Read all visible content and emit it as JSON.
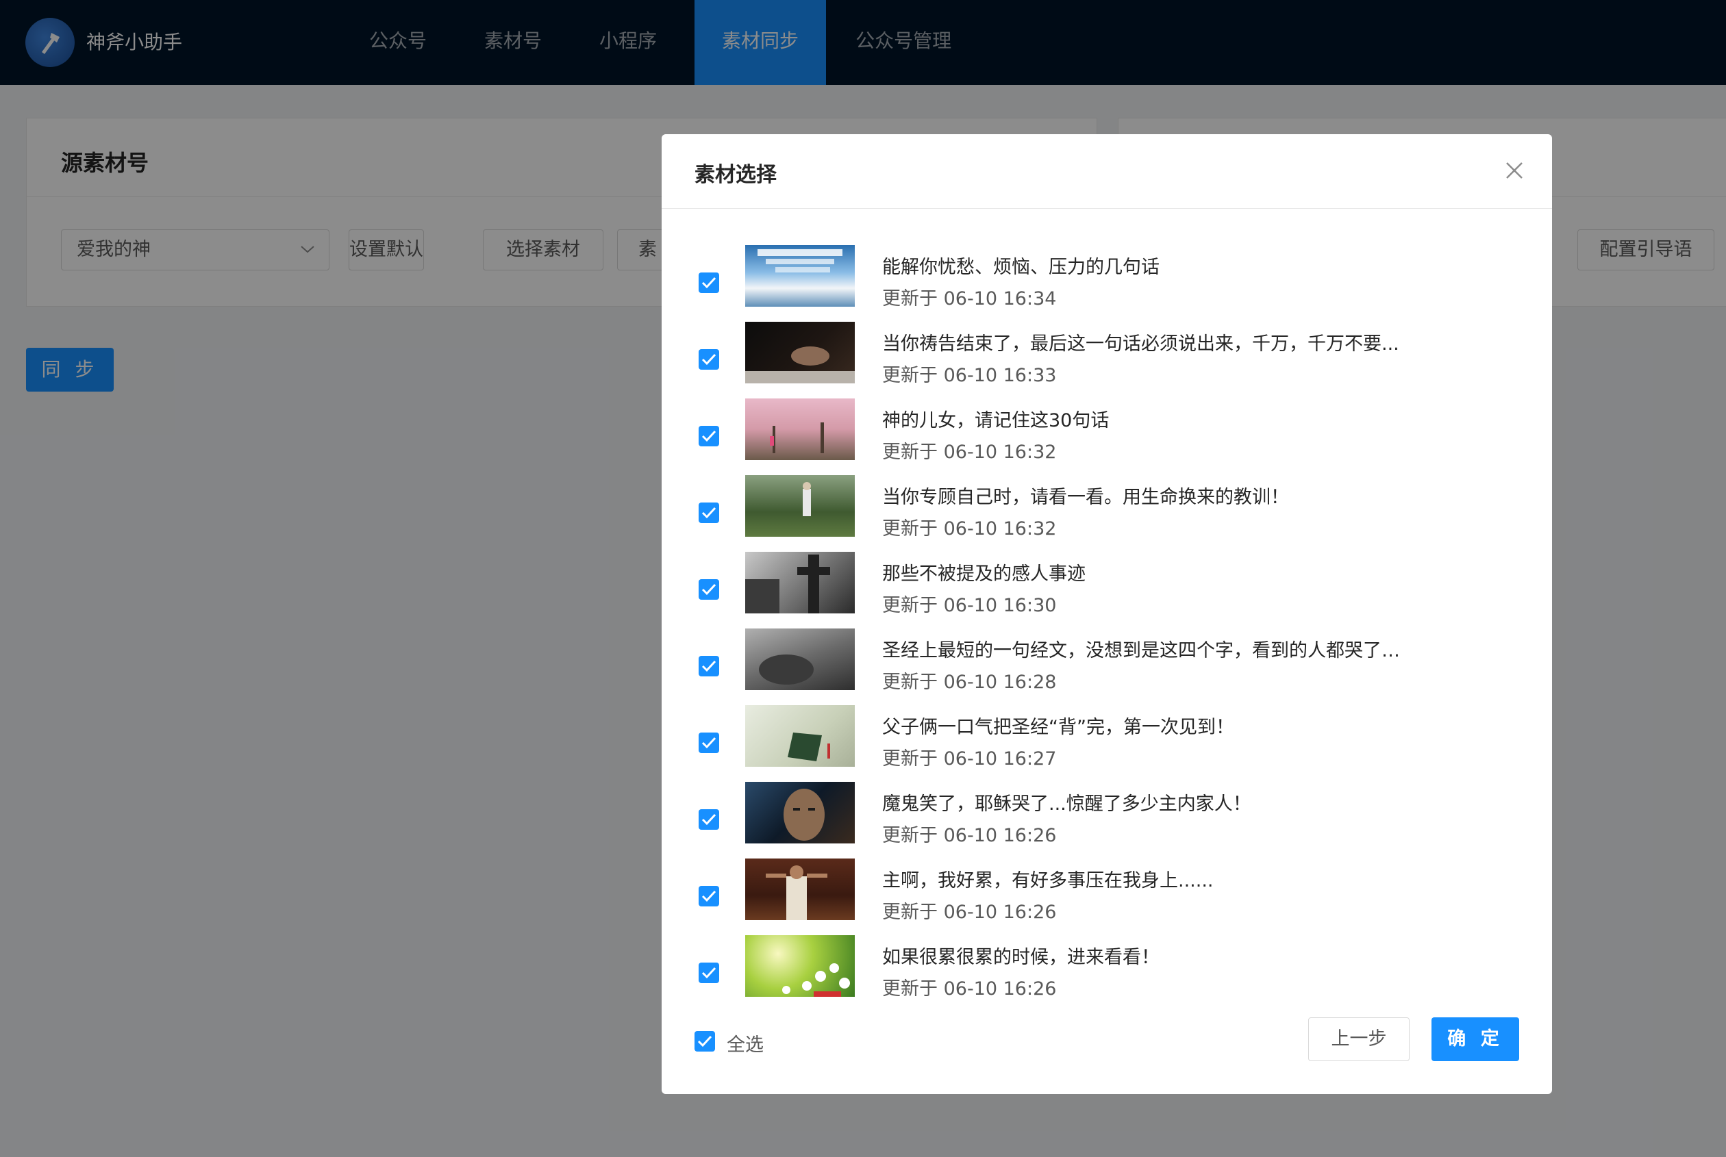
{
  "app": {
    "name": "神斧小助手"
  },
  "nav": {
    "items": [
      {
        "label": "公众号"
      },
      {
        "label": "素材号"
      },
      {
        "label": "小程序"
      },
      {
        "label": "素材同步",
        "active": true
      },
      {
        "label": "公众号管理"
      }
    ]
  },
  "source_card": {
    "title": "源素材号",
    "account_select": {
      "value": "爱我的神"
    },
    "set_default_label": "设置默认",
    "select_material_label": "选择素材",
    "partial_button_label": "素"
  },
  "target_card": {
    "config_guide_label": "配置引导语"
  },
  "sync_button_label": "同 步",
  "modal": {
    "title": "素材选择",
    "items": [
      {
        "title": "能解你忧愁、烦恼、压力的几句话",
        "time": "更新于 06-10 16:34",
        "checked": true,
        "thumb": "sky"
      },
      {
        "title": "当你祷告结束了，最后这一句话必须说出来，千万，千万不要...",
        "time": "更新于 06-10 16:33",
        "checked": true,
        "thumb": "hands"
      },
      {
        "title": "神的儿女，请记住这30句话",
        "time": "更新于 06-10 16:32",
        "checked": true,
        "thumb": "blossom"
      },
      {
        "title": "当你专顾自己时，请看一看。用生命换来的教训！",
        "time": "更新于 06-10 16:32",
        "checked": true,
        "thumb": "forest"
      },
      {
        "title": "那些不被提及的感人事迹",
        "time": "更新于 06-10 16:30",
        "checked": true,
        "thumb": "cross"
      },
      {
        "title": "圣经上最短的一句经文，没想到是这四个字，看到的人都哭了…",
        "time": "更新于 06-10 16:28",
        "checked": true,
        "thumb": "grey"
      },
      {
        "title": "父子俩一口气把圣经“背”完，第一次见到！",
        "time": "更新于 06-10 16:27",
        "checked": true,
        "thumb": "bible"
      },
      {
        "title": "魔鬼笑了，耶稣哭了...惊醒了多少主内家人！",
        "time": "更新于 06-10 16:26",
        "checked": true,
        "thumb": "face"
      },
      {
        "title": "主啊，我好累，有好多事压在我身上......",
        "time": "更新于 06-10 16:26",
        "checked": true,
        "thumb": "jesus"
      },
      {
        "title": "如果很累很累的时候，进来看看！",
        "time": "更新于 06-10 16:26",
        "checked": true,
        "thumb": "flowers"
      }
    ],
    "select_all_label": "全选",
    "prev_label": "上一步",
    "ok_label": "确 定"
  },
  "colors": {
    "nav_bg": "#001529",
    "primary": "#1890ff"
  }
}
